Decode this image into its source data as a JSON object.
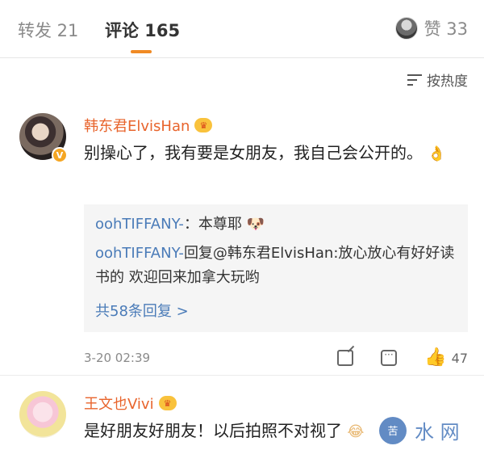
{
  "tabs": {
    "repost": "转发 21",
    "comments": "评论 165",
    "likes": "赞 33"
  },
  "sort": {
    "label": "按热度"
  },
  "comments": [
    {
      "user": "韩东君ElvisHan",
      "text": "别操心了，我有要是女朋友，我自己会公开的。",
      "emoji": "👌",
      "replies": [
        {
          "user": "oohTIFFANY-",
          "text": "：本尊耶",
          "emoji": "🐶"
        },
        {
          "user": "oohTIFFANY-",
          "text": "回复@韩东君ElvisHan:放心放心有好好读书的 欢迎回来加拿大玩哟"
        }
      ],
      "reply_count_label": "共58条回复 >",
      "timestamp": "3-20 02:39",
      "likes": "47"
    },
    {
      "user": "王文也Vivi",
      "text": "是好朋友好朋友！以后拍照不对视了",
      "emoji": "😂"
    }
  ],
  "watermark": {
    "logo": "苦",
    "text": "水 网"
  },
  "icons": {
    "sort": "sort-lines-icon",
    "vip": "vip-crown-icon",
    "verified": "verified-v-icon",
    "repost": "repost-icon",
    "comment": "comment-icon",
    "like": "thumbs-up-icon"
  },
  "colors": {
    "accent": "#f08a24",
    "username": "#e8642c",
    "link": "#4a7bb8"
  }
}
